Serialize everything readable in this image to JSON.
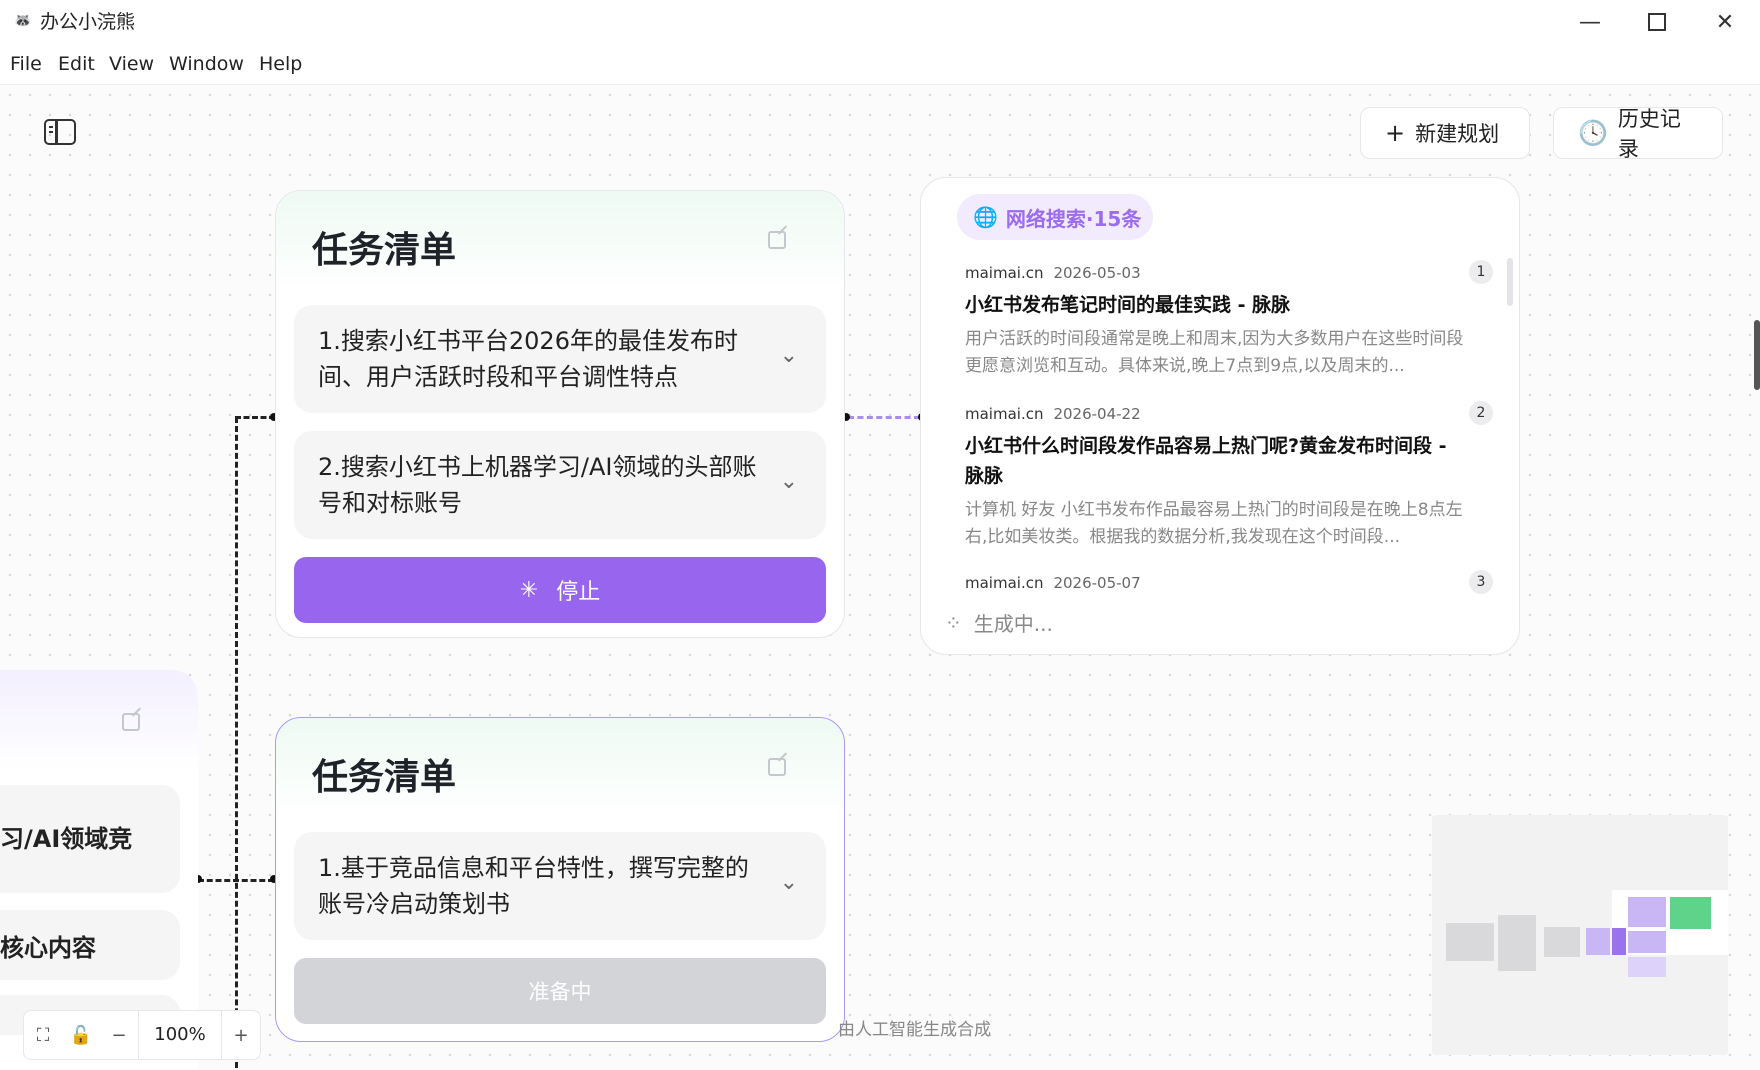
{
  "window": {
    "app_icon": "raccoon-icon",
    "title": "办公小浣熊",
    "controls": [
      "minimize-icon",
      "maximize-icon",
      "close-icon"
    ]
  },
  "menu": [
    "File",
    "Edit",
    "View",
    "Window",
    "Help"
  ],
  "toolbar": {
    "new_plan": "新建规划",
    "history": "历史记录"
  },
  "task_card_1": {
    "title": "任务清单",
    "tasks": [
      "1.搜索小红书平台2026年的最佳发布时间、用户活跃时段和平台调性特点",
      "2.搜索小红书上机器学习/AI领域的头部账号和对标账号"
    ],
    "stop_label": "停止"
  },
  "task_card_2": {
    "title": "任务清单",
    "tasks": [
      "1.基于竞品信息和平台特性，撰写完整的账号冷启动策划书"
    ],
    "status_label": "准备中"
  },
  "left_card": {
    "items": [
      "习/AI领域竞",
      "核心内容"
    ]
  },
  "search": {
    "tag": "网络搜索·15条",
    "results": [
      {
        "source": "maimai.cn",
        "date": "2026-05-03",
        "index": "1",
        "title": "小红书发布笔记时间的最佳实践 - 脉脉",
        "desc": "用户活跃的时间段通常是晚上和周末,因为大多数用户在这些时间段更愿意浏览和互动。具体来说,晚上7点到9点,以及周末的..."
      },
      {
        "source": "maimai.cn",
        "date": "2026-04-22",
        "index": "2",
        "title": "小红书什么时间段发作品容易上热门呢?黄金发布时间段 - 脉脉",
        "desc": "计算机 好友 小红书发布作品最容易上热门的时间段是在晚上8点左右,比如美妆类。根据我的数据分析,我发现在这个时间段..."
      },
      {
        "source": "maimai.cn",
        "date": "2026-05-07",
        "index": "3",
        "title": "",
        "desc": ""
      }
    ],
    "generating": "生成中..."
  },
  "zoom": {
    "level": "100%",
    "minus": "−",
    "plus": "+"
  },
  "footnote": "由人工智能生成合成"
}
